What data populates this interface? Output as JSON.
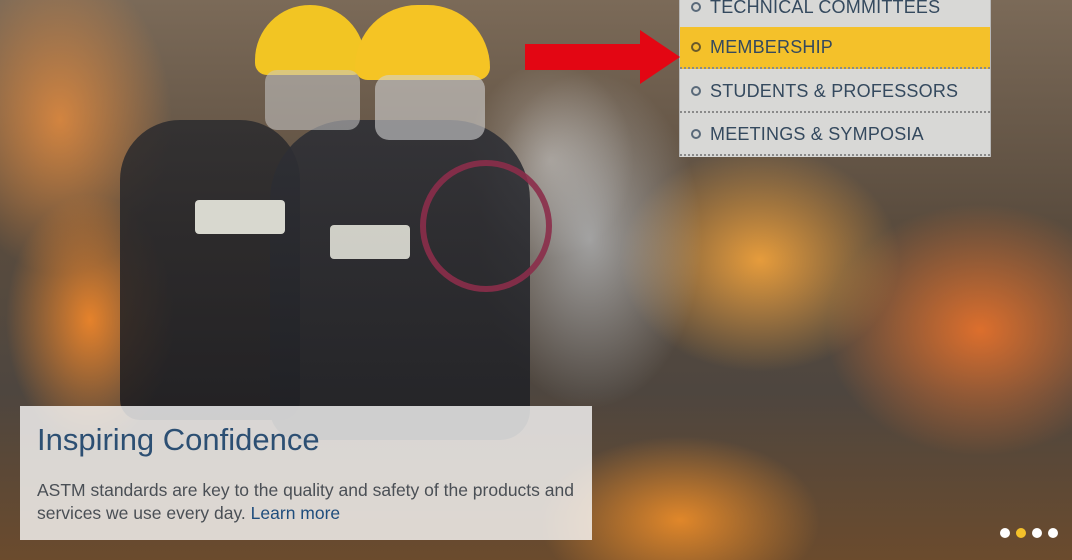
{
  "menu": {
    "items": [
      {
        "label": "TECHNICAL COMMITTEES",
        "active": false
      },
      {
        "label": "MEMBERSHIP",
        "active": true
      },
      {
        "label": "STUDENTS & PROFESSORS",
        "active": false
      },
      {
        "label": "MEETINGS & SYMPOSIA",
        "active": false
      }
    ],
    "active_color": "#f4c12a"
  },
  "annotation": {
    "arrow_color": "#e30613"
  },
  "hero": {
    "title": "Inspiring Confidence",
    "body": "ASTM standards are key to the quality and safety of the products and services we use every day.",
    "link_label": "Learn more"
  },
  "carousel": {
    "slide_count": 4,
    "active_index": 1,
    "active_dot_color": "#f4c12a"
  }
}
